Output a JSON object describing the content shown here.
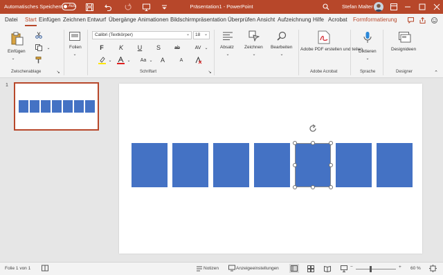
{
  "titlebar": {
    "autosave_label": "Automatisches Speichern",
    "autosave_state": "Aus",
    "doc_title": "Präsentation1 - PowerPoint",
    "user_name": "Stefan Malter"
  },
  "tabs": [
    {
      "label": "Datei"
    },
    {
      "label": "Start"
    },
    {
      "label": "Einfügen"
    },
    {
      "label": "Zeichnen"
    },
    {
      "label": "Entwurf"
    },
    {
      "label": "Übergänge"
    },
    {
      "label": "Animationen"
    },
    {
      "label": "Bildschirmpräsentation"
    },
    {
      "label": "Überprüfen"
    },
    {
      "label": "Ansicht"
    },
    {
      "label": "Aufzeichnung"
    },
    {
      "label": "Hilfe"
    },
    {
      "label": "Acrobat"
    },
    {
      "label": "Formformatierung"
    }
  ],
  "ribbon": {
    "clipboard": {
      "paste_label": "Einfügen",
      "group_label": "Zwischenablage"
    },
    "slides": {
      "label": "Folien"
    },
    "font": {
      "name": "Calibri (Textkörper)",
      "size": "18",
      "group_label": "Schriftart",
      "bold": "F",
      "italic": "K",
      "underline": "U",
      "shadow": "S",
      "strike": "ab",
      "spacing": "AV",
      "case": "Aa",
      "grow": "A",
      "shrink": "A"
    },
    "paragraph": {
      "label": "Absatz"
    },
    "drawing": {
      "label": "Zeichnen"
    },
    "editing": {
      "label": "Bearbeiten"
    },
    "acrobat": {
      "button_label": "Adobe PDF erstellen und teilen",
      "group_label": "Adobe Acrobat"
    },
    "speech": {
      "button_label": "Diktieren",
      "group_label": "Sprache"
    },
    "designer": {
      "button_label": "Designideen",
      "group_label": "Designer"
    }
  },
  "slides_pane": {
    "slide_number": "1"
  },
  "statusbar": {
    "slide_info": "Folie 1 von 1",
    "notes": "Notizen",
    "display_settings": "Anzeigeeinstellungen",
    "zoom": "60 %"
  },
  "colors": {
    "accent": "#b7472a",
    "shape_fill": "#4472c4"
  }
}
